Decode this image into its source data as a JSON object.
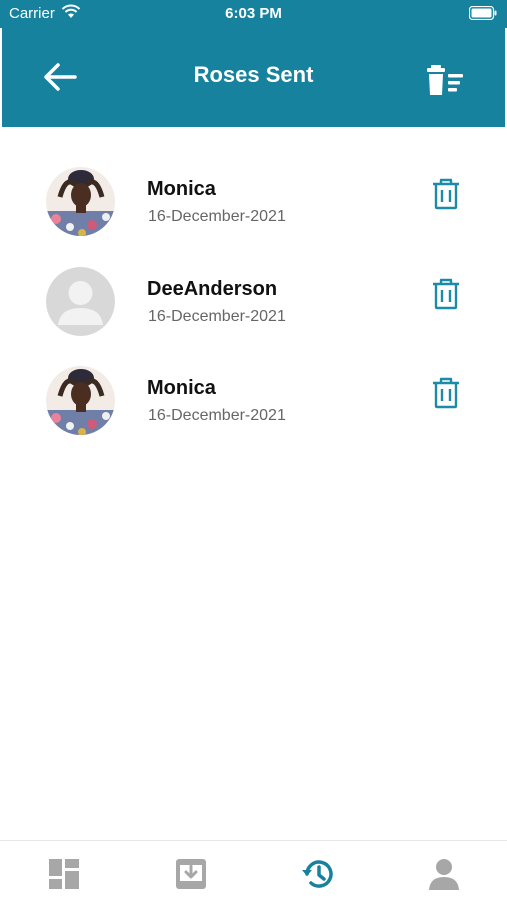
{
  "status_bar": {
    "carrier": "Carrier",
    "time": "6:03 PM"
  },
  "header": {
    "title": "Roses Sent",
    "back_icon": "arrow-left-icon",
    "action_icon": "delete-all-icon"
  },
  "roses": [
    {
      "name": "Monica",
      "date": "16-December-2021",
      "avatar": "photo"
    },
    {
      "name": "DeeAnderson",
      "date": "16-December-2021",
      "avatar": "placeholder"
    },
    {
      "name": "Monica",
      "date": "16-December-2021",
      "avatar": "photo"
    }
  ],
  "tabs": [
    {
      "icon": "dashboard-icon",
      "active": false
    },
    {
      "icon": "inbox-download-icon",
      "active": false
    },
    {
      "icon": "history-icon",
      "active": true
    },
    {
      "icon": "profile-icon",
      "active": false
    }
  ],
  "colors": {
    "primary": "#16829e",
    "inactive_icon": "#a7a7a7",
    "trash_icon": "#1b8ba7"
  }
}
